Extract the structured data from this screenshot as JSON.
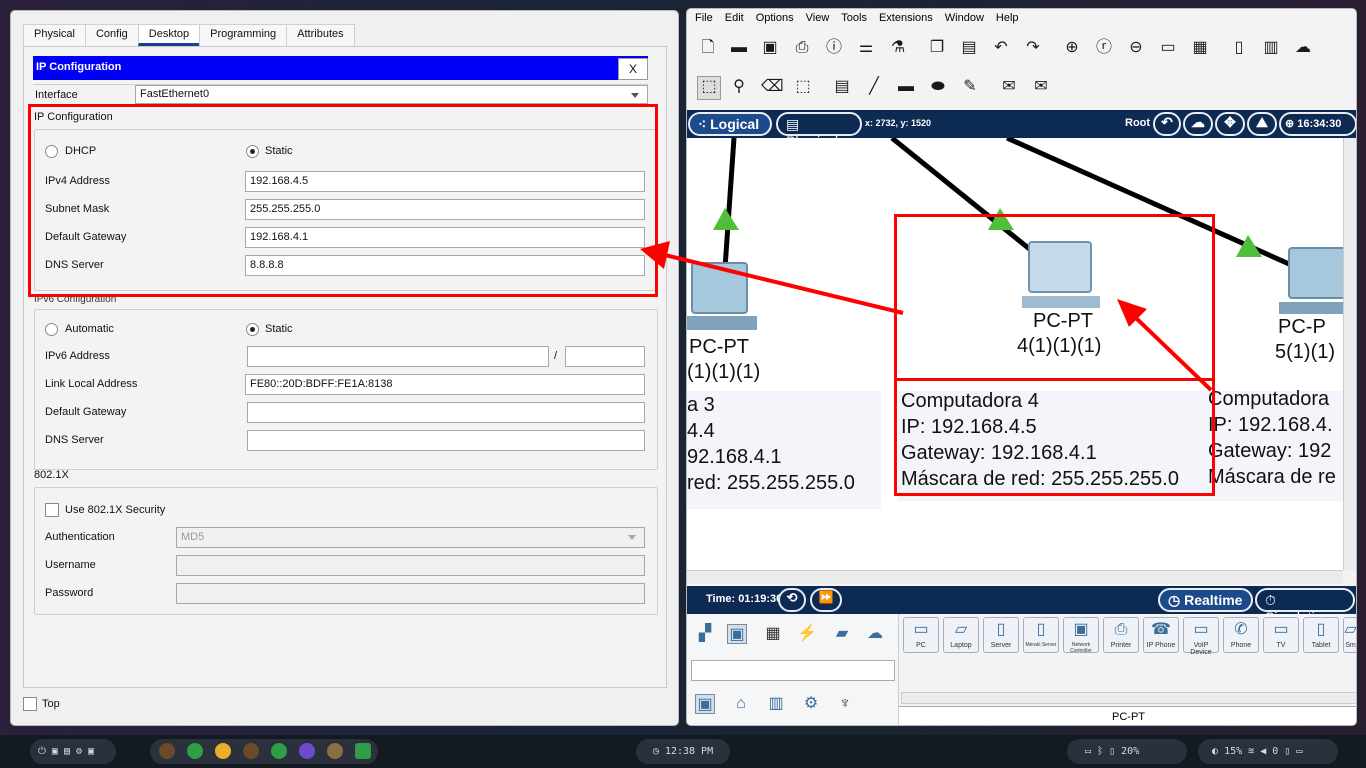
{
  "left_window": {
    "tabs": [
      "Physical",
      "Config",
      "Desktop",
      "Programming",
      "Attributes"
    ],
    "active_tab": "Desktop",
    "header_title": "IP Configuration",
    "close_label": "X",
    "interface_label": "Interface",
    "interface_value": "FastEthernet0",
    "ipv4_section_title": "IP Configuration",
    "ipv4": {
      "dhcp_label": "DHCP",
      "static_label": "Static",
      "mode": "Static",
      "address_label": "IPv4 Address",
      "address": "192.168.4.5",
      "mask_label": "Subnet Mask",
      "mask": "255.255.255.0",
      "gateway_label": "Default Gateway",
      "gateway": "192.168.4.1",
      "dns_label": "DNS Server",
      "dns": "8.8.8.8"
    },
    "ipv6_section_title": "IPv6 Configuration",
    "ipv6": {
      "auto_label": "Automatic",
      "static_label": "Static",
      "mode": "Static",
      "address_label": "IPv6 Address",
      "address": "",
      "prefix_sep": "/",
      "prefix": "",
      "link_local_label": "Link Local Address",
      "link_local": "FE80::20D:BDFF:FE1A:8138",
      "gateway_label": "Default Gateway",
      "gateway": "",
      "dns_label": "DNS Server",
      "dns": ""
    },
    "dot1x_section_title": "802.1X",
    "dot1x": {
      "use_label": "Use 802.1X Security",
      "use_checked": false,
      "auth_label": "Authentication",
      "auth_value": "MD5",
      "username_label": "Username",
      "password_label": "Password"
    },
    "top_label": "Top"
  },
  "right_window": {
    "menu": [
      "File",
      "Edit",
      "Options",
      "View",
      "Tools",
      "Extensions",
      "Window",
      "Help"
    ],
    "logical_label": "Logical",
    "physical_label": "Physical",
    "coords_text": "x: 2732, y: 1520",
    "root_label": "Root",
    "clock": "16:34:30",
    "canvas": {
      "pc3": {
        "type": "PC-PT",
        "name": "(1)(1)(1)"
      },
      "pc4": {
        "type": "PC-PT",
        "name": "4(1)(1)(1)"
      },
      "pc5": {
        "type": "PC-P",
        "name": "5(1)(1)"
      },
      "note3": [
        "a 3",
        "4.4",
        "92.168.4.1",
        "red: 255.255.255.0"
      ],
      "note4": [
        "Computadora 4",
        "IP: 192.168.4.5",
        "Gateway: 192.168.4.1",
        "Máscara de red: 255.255.255.0"
      ],
      "note5": [
        "Computadora",
        "IP: 192.168.4.",
        "Gateway: 192",
        "Máscara de re"
      ]
    },
    "time_label": "Time: 01:19:30",
    "realtime_label": "Realtime",
    "simulation_label": "Simulation",
    "devices": [
      "PC",
      "Laptop",
      "Server",
      "Meraki Server",
      "Network Controller",
      "Printer",
      "IP Phone",
      "VoIP Device",
      "Phone",
      "TV",
      "Tablet",
      "Sm"
    ],
    "selected_device": "PC-PT"
  },
  "taskbar": {
    "clock": "12:38 PM",
    "battery": "20%",
    "brightness": "15%",
    "volume": "0"
  },
  "colors": {
    "header_blue": "#0000f6",
    "annotation_red": "#ff0000",
    "pt_navy": "#0d2a52",
    "link_green": "#4fbf3a"
  }
}
